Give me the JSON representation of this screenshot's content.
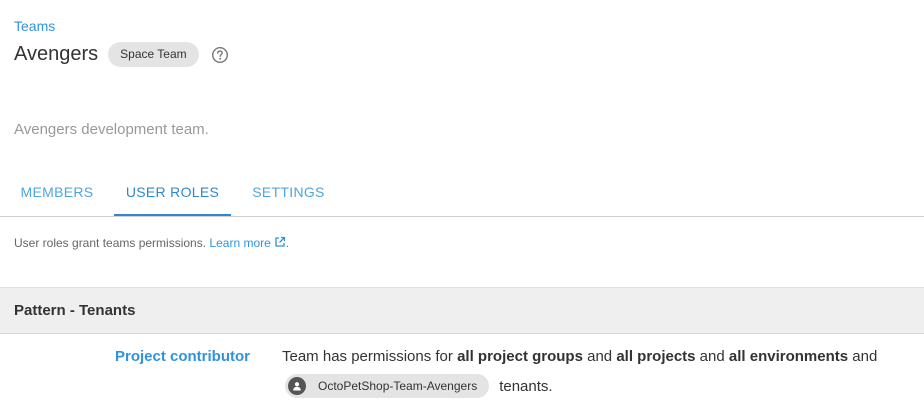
{
  "breadcrumb": {
    "label": "Teams"
  },
  "header": {
    "title": "Avengers",
    "badge": "Space Team"
  },
  "description": "Avengers development team.",
  "tabs": [
    {
      "label": "MEMBERS",
      "active": false
    },
    {
      "label": "USER ROLES",
      "active": true
    },
    {
      "label": "SETTINGS",
      "active": false
    }
  ],
  "hint": {
    "text": "User roles grant teams permissions.",
    "link": "Learn more",
    "suffix": "."
  },
  "section": {
    "title": "Pattern - Tenants"
  },
  "role": {
    "name": "Project contributor",
    "desc_1": "Team has permissions for ",
    "bold_1": "all project groups",
    "desc_2": " and ",
    "bold_2": "all projects",
    "desc_3": " and ",
    "bold_3": "all environments",
    "desc_4": " and",
    "tenant": "OctoPetShop-Team-Avengers",
    "tenant_suffix": "tenants."
  },
  "icons": {
    "help": "help-circle-icon",
    "external": "external-link-icon",
    "tenant": "user-avatar-icon"
  },
  "colors": {
    "accent": "#2f93e0",
    "active_tab": "#2f87cf",
    "badge_bg": "#e4e4e4",
    "section_bg": "#efefef"
  }
}
